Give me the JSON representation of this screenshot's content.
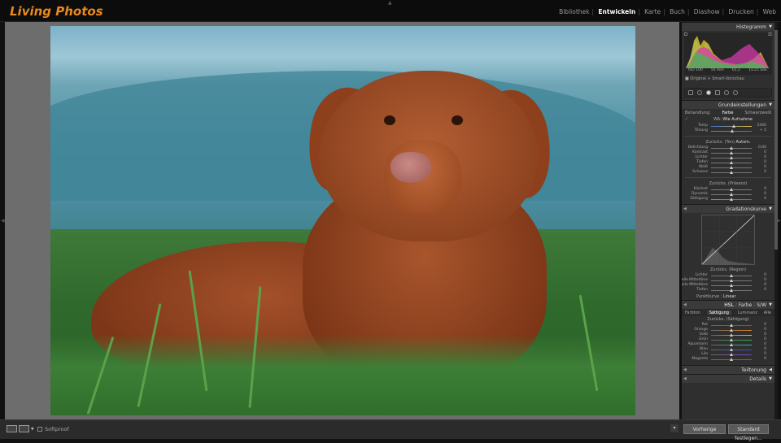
{
  "app": {
    "logo": "Living Photos"
  },
  "modules": [
    {
      "label": "Bibliothek",
      "active": false
    },
    {
      "label": "Entwickeln",
      "active": true
    },
    {
      "label": "Karte",
      "active": false
    },
    {
      "label": "Buch",
      "active": false
    },
    {
      "label": "Diashow",
      "active": false
    },
    {
      "label": "Drucken",
      "active": false
    },
    {
      "label": "Web",
      "active": false
    }
  ],
  "histogram": {
    "title": "Histogramm",
    "readout": [
      "ISO 100",
      "50 mm",
      "f/2,2",
      "1/125 Sek."
    ],
    "original_label": "Original + Smart-Vorschau"
  },
  "basic": {
    "title": "Grundeinstellungen",
    "treatment_label": "Behandlung:",
    "color_label": "Farbe",
    "bw_label": "Schwarzweiß",
    "wb_label": "WA:",
    "wb_value": "Wie Aufnahme",
    "wb_sliders": [
      {
        "label": "Temp",
        "value": "5400",
        "pos": 0.55
      },
      {
        "label": "Tönung",
        "value": "+ 5",
        "pos": 0.52
      }
    ],
    "tone_header": "Zurücks. (Ton)",
    "auto_label": "Autom.",
    "tone_sliders": [
      {
        "label": "Belichtung",
        "value": "0,00",
        "pos": 0.5
      },
      {
        "label": "Kontrast",
        "value": "0",
        "pos": 0.5
      },
      {
        "label": "Lichter",
        "value": "0",
        "pos": 0.5
      },
      {
        "label": "Tiefen",
        "value": "0",
        "pos": 0.5
      },
      {
        "label": "Weiß",
        "value": "0",
        "pos": 0.5
      },
      {
        "label": "Schwarz",
        "value": "0",
        "pos": 0.5
      }
    ],
    "presence_header": "Zurücks. (Präsenz)",
    "presence_sliders": [
      {
        "label": "Klarheit",
        "value": "0",
        "pos": 0.5
      },
      {
        "label": "Dynamik",
        "value": "0",
        "pos": 0.5
      },
      {
        "label": "Sättigung",
        "value": "0",
        "pos": 0.5
      }
    ]
  },
  "tonecurve": {
    "title": "Gradationskurve",
    "region_header": "Zurücks. (Region)",
    "sliders": [
      {
        "label": "Lichter",
        "value": "0",
        "pos": 0.5
      },
      {
        "label": "Helle Mitteltöne",
        "value": "0",
        "pos": 0.5
      },
      {
        "label": "Dunkle Mitteltöne",
        "value": "0",
        "pos": 0.5
      },
      {
        "label": "Tiefen",
        "value": "0",
        "pos": 0.5
      }
    ],
    "point_curve_label": "Punktkurve :",
    "point_curve_value": "Linear"
  },
  "hsl": {
    "title_parts": [
      "HSL",
      "Farbe",
      "S/W"
    ],
    "tabs": [
      "Farbton",
      "Sättigung",
      "Luminanz",
      "Alle"
    ],
    "selected_tab": "Sättigung",
    "reset_label": "Zurücks. (Sättigung)",
    "sliders": [
      {
        "label": "Rot",
        "value": "0",
        "pos": 0.5
      },
      {
        "label": "Orange",
        "value": "0",
        "pos": 0.5
      },
      {
        "label": "Gelb",
        "value": "0",
        "pos": 0.5
      },
      {
        "label": "Grün",
        "value": "0",
        "pos": 0.5
      },
      {
        "label": "Aquamarin",
        "value": "0",
        "pos": 0.5
      },
      {
        "label": "Blau",
        "value": "0",
        "pos": 0.5
      },
      {
        "label": "Lila",
        "value": "0",
        "pos": 0.5
      },
      {
        "label": "Magenta",
        "value": "0",
        "pos": 0.5
      }
    ]
  },
  "split_toning": {
    "title": "Teiltonung"
  },
  "details": {
    "title": "Details"
  },
  "toolbar": {
    "softproof_label": "Softproof",
    "previous_label": "Vorherige",
    "reset_label": "Standard festlegen..."
  },
  "colors": {
    "accent": "#e8891e",
    "panel": "#2f2f2f",
    "background": "#6d6d6d"
  }
}
